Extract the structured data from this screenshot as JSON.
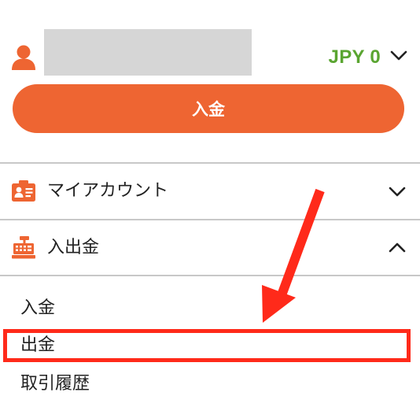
{
  "account": {
    "currency": "JPY",
    "balance": "0",
    "balance_label": "JPY 0"
  },
  "deposit_button": {
    "label": "入金"
  },
  "menu": [
    {
      "label": "マイアカウント",
      "icon": "id-card-icon",
      "expanded": false
    },
    {
      "label": "入出金",
      "icon": "cash-register-icon",
      "expanded": true,
      "subitems": [
        "入金",
        "出金",
        "取引履歴"
      ]
    }
  ],
  "colors": {
    "accent": "#ee6532",
    "balance_green": "#5aa531",
    "annotation_red": "#ff2a1a",
    "name_placeholder": "#d6d6d6"
  }
}
